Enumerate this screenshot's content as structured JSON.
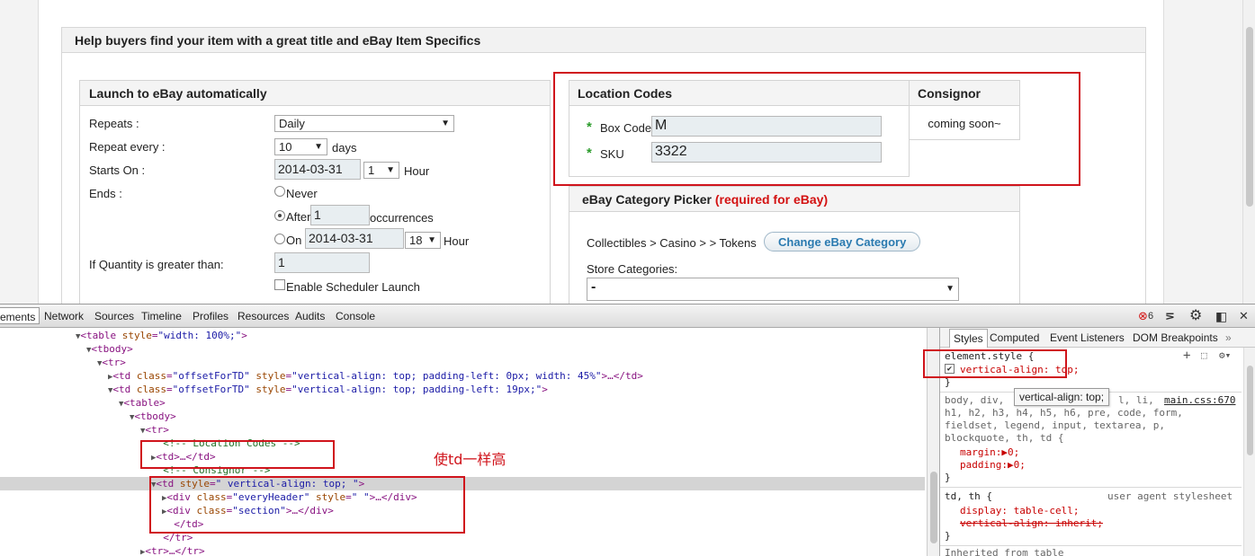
{
  "page": {
    "main_title": "Help buyers find your item with a great title and eBay Item Specifics",
    "launch": {
      "title": "Launch to eBay automatically",
      "repeats_label": "Repeats :",
      "repeats_value": "Daily",
      "repeat_every_label": "Repeat every :",
      "repeat_every_value": "10",
      "days_label": "days",
      "starts_on_label": "Starts On :",
      "starts_on_date": "2014-03-31",
      "starts_on_hour": "1",
      "hour_label": "Hour",
      "ends_label": "Ends :",
      "never_label": "Never",
      "after_label": "After",
      "after_value": "1",
      "occurrences_label": "occurrences",
      "on_label": "On",
      "on_date": "2014-03-31",
      "on_hour": "18",
      "on_hour_label": "Hour",
      "qty_label": "If Quantity is greater than:",
      "qty_value": "1",
      "enable_label": "Enable Scheduler Launch"
    },
    "location": {
      "title": "Location Codes",
      "star": "*",
      "box_code_label": "Box Code",
      "box_code_value": "M",
      "sku_label": "SKU",
      "sku_value": "3322"
    },
    "consignor": {
      "title": "Consignor",
      "text": "coming soon~"
    },
    "category": {
      "title": "eBay Category Picker",
      "required": "(required for eBay)",
      "path": "Collectibles > Casino > > Tokens",
      "change_button": "Change eBay Category",
      "store_label": "Store Categories:",
      "store_value": "-"
    }
  },
  "annotation": {
    "text": "使td一样高",
    "color": "#d0141c"
  },
  "devtools": {
    "tabs": [
      "ements",
      "Network",
      "Sources",
      "Timeline",
      "Profiles",
      "Resources",
      "Audits",
      "Console"
    ],
    "error_count": "6",
    "dom_lines": [
      {
        "indent": 84,
        "tri": "▼",
        "html": "<table style=\"width: 100%;\">"
      },
      {
        "indent": 96,
        "tri": "▼",
        "html": "<tbody>"
      },
      {
        "indent": 108,
        "tri": "▼",
        "html": "<tr>"
      },
      {
        "indent": 120,
        "tri": "▶",
        "html": "<td class=\"offsetForTD\" style=\"vertical-align: top; padding-left: 0px; width: 45%\">…</td>"
      },
      {
        "indent": 120,
        "tri": "▼",
        "html": "<td class=\"offsetForTD\" style=\"vertical-align: top; padding-left: 19px;\">"
      },
      {
        "indent": 132,
        "tri": "▼",
        "html": "<table>"
      },
      {
        "indent": 144,
        "tri": "▼",
        "html": "<tbody>"
      },
      {
        "indent": 156,
        "tri": "▼",
        "html": "<tr>"
      },
      {
        "indent": 168,
        "tri": "",
        "html": "<!-- Location Codes -->",
        "comment": true
      },
      {
        "indent": 168,
        "tri": "▶",
        "html": "<td>…</td>"
      },
      {
        "indent": 168,
        "tri": "",
        "html": "<!-- Consignor -->",
        "comment": true
      },
      {
        "indent": 168,
        "tri": "▼",
        "html": "<td style=\" vertical-align: top; \">",
        "selected": true
      },
      {
        "indent": 180,
        "tri": "▶",
        "html": "<div class=\"everyHeader\" style=\" \">…</div>"
      },
      {
        "indent": 180,
        "tri": "▶",
        "html": "<div class=\"section\">…</div>"
      },
      {
        "indent": 180,
        "tri": "",
        "html": "</td>"
      },
      {
        "indent": 168,
        "tri": "",
        "html": "</tr>"
      },
      {
        "indent": 156,
        "tri": "▶",
        "html": "<tr>…</tr>"
      }
    ],
    "styles_tabs": [
      "Styles",
      "Computed",
      "Event Listeners",
      "DOM Breakpoints"
    ],
    "styles": {
      "element_style": "element.style {",
      "element_prop": "vertical-align: top;",
      "close": "}",
      "tooltip": "vertical-align: top;",
      "rule1_selector_a": "body, div,",
      "rule1_selector_b": "l, li,",
      "rule1_source": "main.css:670",
      "rule1_selector_c": "h1, h2, h3, h4, h5, h6, pre, code, form,",
      "rule1_selector_d": "fieldset, legend, input, textarea, p,",
      "rule1_selector_e": "blockquote, th, td {",
      "rule1_margin": "margin:▶0;",
      "rule1_padding": "padding:▶0;",
      "rule2_selector": "td, th {",
      "rule2_source": "user agent stylesheet",
      "rule2_display": "display: table-cell;",
      "rule2_va": "vertical-align: inherit;",
      "inherited": "Inherited from table"
    }
  }
}
